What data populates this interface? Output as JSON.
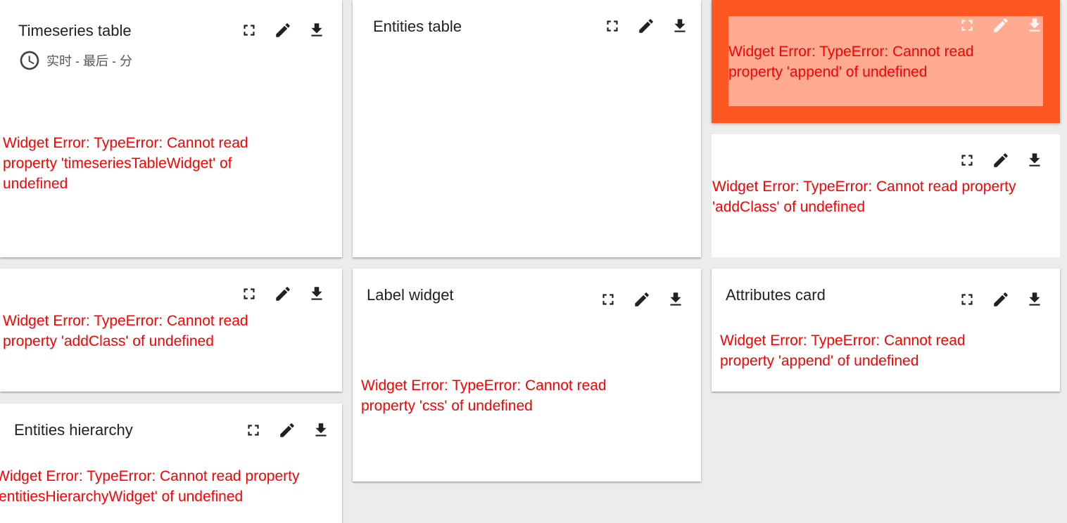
{
  "widgets": {
    "timeseries": {
      "title": "Timeseries table",
      "timewindow": "实时 - 最后 - 分",
      "error": "Widget Error: TypeError: Cannot read property 'timeseriesTableWidget' of undefined"
    },
    "entities_table": {
      "title": "Entities table"
    },
    "error_active": {
      "error": "Widget Error: TypeError: Cannot read property 'append' of undefined"
    },
    "addclass_right": {
      "error": "Widget Error: TypeError: Cannot read property 'addClass' of undefined"
    },
    "addclass_left": {
      "error": "Widget Error: TypeError: Cannot read property 'addClass' of undefined"
    },
    "label": {
      "title": "Label widget",
      "error": "Widget Error: TypeError: Cannot read property 'css' of undefined"
    },
    "attributes": {
      "title": "Attributes card",
      "error": "Widget Error: TypeError: Cannot read property 'append' of undefined"
    },
    "hierarchy": {
      "title": "Entities hierarchy",
      "error": "Widget Error: TypeError: Cannot read property 'entitiesHierarchyWidget' of undefined"
    }
  },
  "icons": {
    "fullscreen": "fullscreen-icon",
    "edit": "edit-icon",
    "download": "download-icon",
    "clock": "clock-icon"
  },
  "colors": {
    "error_text": "#ff0000",
    "error_widget_bg": "#ff5722",
    "dashboard_bg": "#ececec"
  }
}
